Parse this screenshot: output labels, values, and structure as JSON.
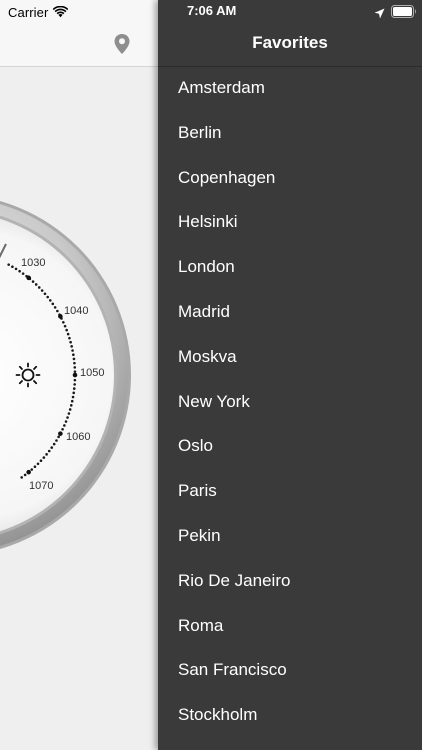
{
  "status_bar": {
    "carrier": "Carrier",
    "time": "7:06 AM"
  },
  "main": {
    "icons": [
      "wifi-icon",
      "location-pin-icon",
      "sun-icon",
      "location-arrow-icon",
      "battery-icon"
    ],
    "gauge": {
      "tick_labels": [
        "1030",
        "1040",
        "1050",
        "1060",
        "1070"
      ],
      "dial_color": "#ffffff",
      "rim_color": "#9a9a9a"
    }
  },
  "favorites": {
    "title": "Favorites",
    "items": [
      "Amsterdam",
      "Berlin",
      "Copenhagen",
      "Helsinki",
      "London",
      "Madrid",
      "Moskva",
      "New York",
      "Oslo",
      "Paris",
      "Pekin",
      "Rio De Janeiro",
      "Roma",
      "San Francisco",
      "Stockholm"
    ]
  },
  "colors": {
    "favorites_background": "#3a3a3a",
    "favorites_text": "#ffffff",
    "main_background": "#efefef"
  }
}
